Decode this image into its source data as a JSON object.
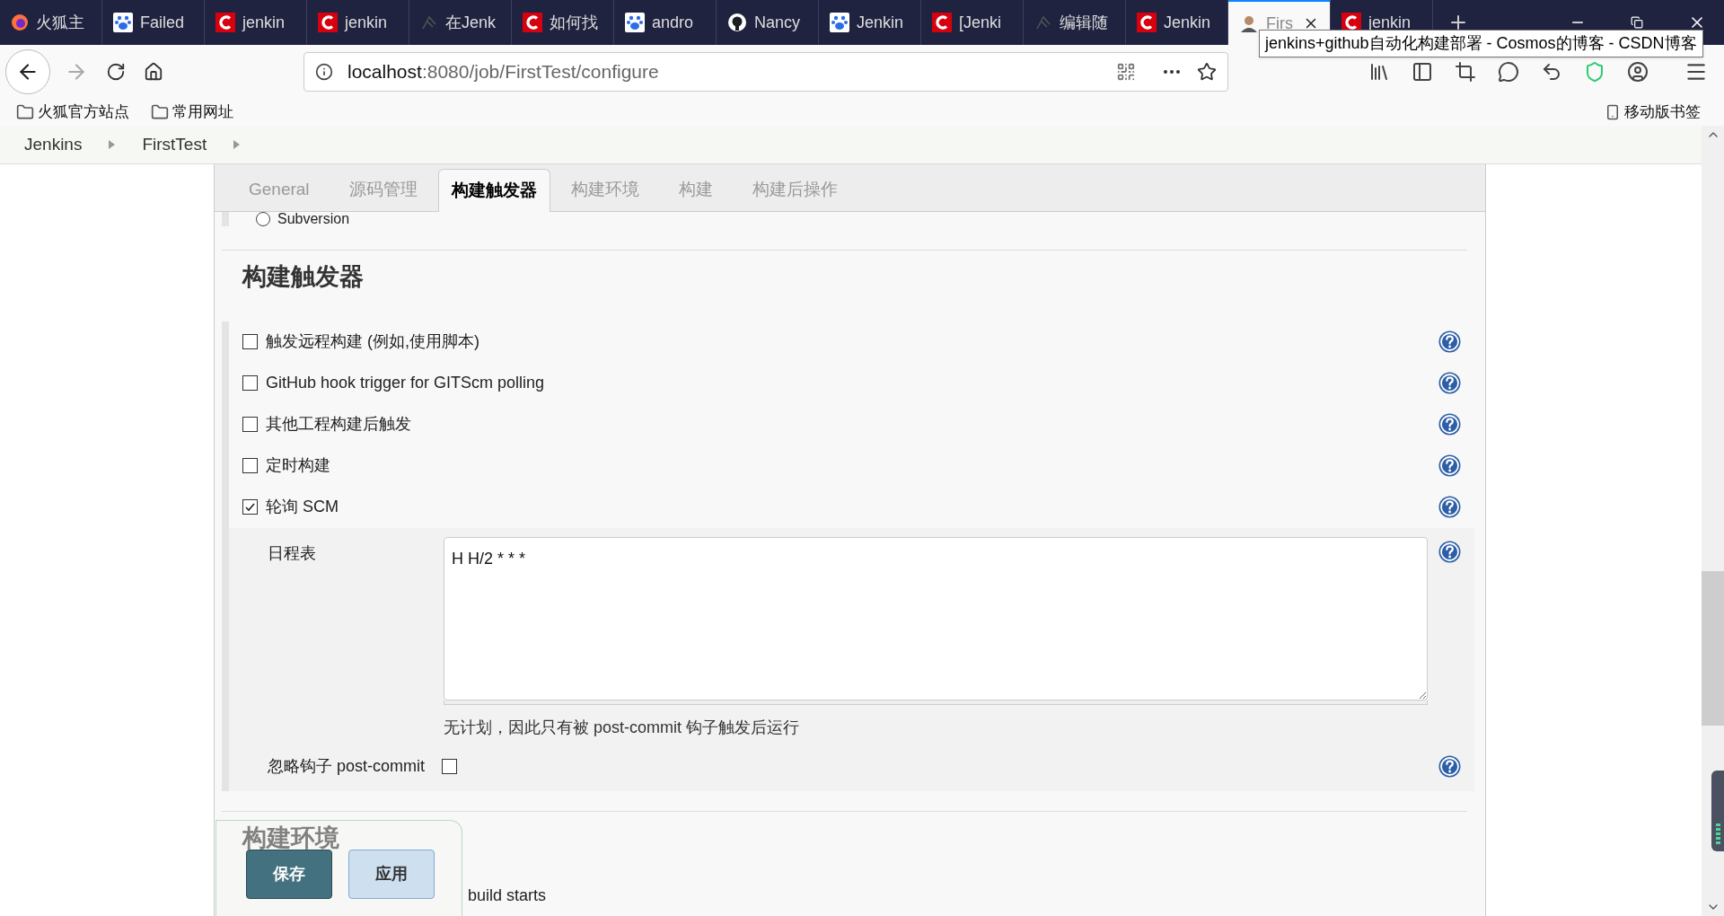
{
  "browser_tabs": [
    {
      "title": "火狐主",
      "kind": "firefox",
      "selected": false
    },
    {
      "title": "Failed",
      "kind": "paw",
      "selected": false
    },
    {
      "title": "jenkin",
      "kind": "c",
      "selected": false
    },
    {
      "title": "jenkin",
      "kind": "c",
      "selected": false
    },
    {
      "title": "在Jenk",
      "kind": "feather",
      "selected": false
    },
    {
      "title": "如何找",
      "kind": "c",
      "selected": false
    },
    {
      "title": "andro",
      "kind": "paw",
      "selected": false
    },
    {
      "title": "Nancy",
      "kind": "github",
      "selected": false
    },
    {
      "title": "Jenkin",
      "kind": "paw",
      "selected": false
    },
    {
      "title": "[Jenki",
      "kind": "c",
      "selected": false
    },
    {
      "title": "编辑随",
      "kind": "feather",
      "selected": false
    },
    {
      "title": "Jenkin",
      "kind": "c",
      "selected": false
    },
    {
      "title": "Firs",
      "kind": "person",
      "selected": true
    },
    {
      "title": "jenkin",
      "kind": "c",
      "selected": false
    }
  ],
  "tooltip": "jenkins+github自动化构建部署 - Cosmos的博客 - CSDN博客",
  "address_bar": {
    "host": "localhost",
    "path": ":8080/job/FirstTest/configure"
  },
  "bookmarks": [
    {
      "label": "火狐官方站点"
    },
    {
      "label": "常用网址"
    }
  ],
  "mobile_bookmarks": "移动版书签",
  "breadcrumbs": [
    "Jenkins",
    "FirstTest"
  ],
  "config_tabs": [
    {
      "label": "General",
      "selected": false
    },
    {
      "label": "源码管理",
      "selected": false
    },
    {
      "label": "构建触发器",
      "selected": true
    },
    {
      "label": "构建环境",
      "selected": false
    },
    {
      "label": "构建",
      "selected": false
    },
    {
      "label": "构建后操作",
      "selected": false
    }
  ],
  "scm_option": {
    "label": "Subversion",
    "selected": false
  },
  "section_title": "构建触发器",
  "triggers": [
    {
      "label": "触发远程构建 (例如,使用脚本)",
      "checked": false
    },
    {
      "label": "GitHub hook trigger for GITScm polling",
      "checked": false
    },
    {
      "label": "其他工程构建后触发",
      "checked": false
    },
    {
      "label": "定时构建",
      "checked": false
    },
    {
      "label": "轮询 SCM",
      "checked": true
    }
  ],
  "schedule": {
    "label": "日程表",
    "value": "H H/2 * * *",
    "hint": "无计划，因此只有被 post-commit 钩子触发后运行"
  },
  "ignore_hook": {
    "label": "忽略钩子 post-commit",
    "checked": false
  },
  "next_section": {
    "title": "构建环境",
    "option": {
      "label": "build starts"
    }
  },
  "buttons": [
    {
      "label": "保存",
      "kind": "primary"
    },
    {
      "label": "应用",
      "kind": "secondary"
    }
  ]
}
